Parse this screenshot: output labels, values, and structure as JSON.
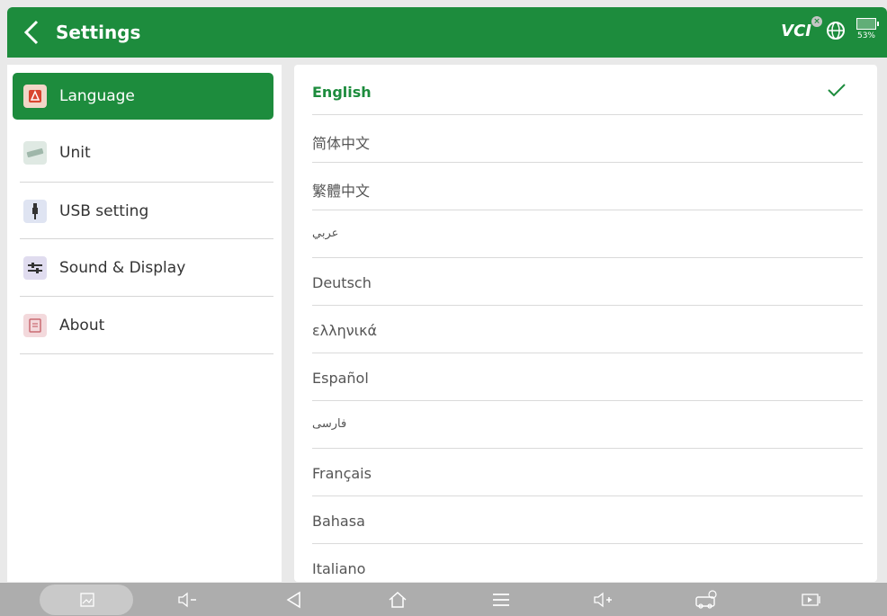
{
  "header": {
    "title": "Settings",
    "vci_label": "VCI",
    "battery_percent": "53%",
    "colors": {
      "bar": "#1d8c3d",
      "text": "#ffffff"
    }
  },
  "sidebar": {
    "items": [
      {
        "label": "Language",
        "icon": "language-icon",
        "active": true
      },
      {
        "label": "Unit",
        "icon": "ruler-icon",
        "active": false
      },
      {
        "label": "USB setting",
        "icon": "usb-icon",
        "active": false
      },
      {
        "label": "Sound & Display",
        "icon": "sliders-icon",
        "active": false
      },
      {
        "label": "About",
        "icon": "document-icon",
        "active": false
      }
    ]
  },
  "languages": {
    "selected": "English",
    "items": [
      "English",
      "简体中文",
      "繁體中文",
      "عربي",
      "Deutsch",
      "ελληνικά",
      "Español",
      "فارسی",
      "Français",
      "Bahasa",
      "Italiano"
    ]
  },
  "navbar": {
    "icons": [
      "gallery-icon",
      "volume-down-icon",
      "back-icon",
      "home-icon",
      "menu-icon",
      "volume-up-icon",
      "car-diagnostic-icon",
      "screen-record-icon"
    ]
  }
}
